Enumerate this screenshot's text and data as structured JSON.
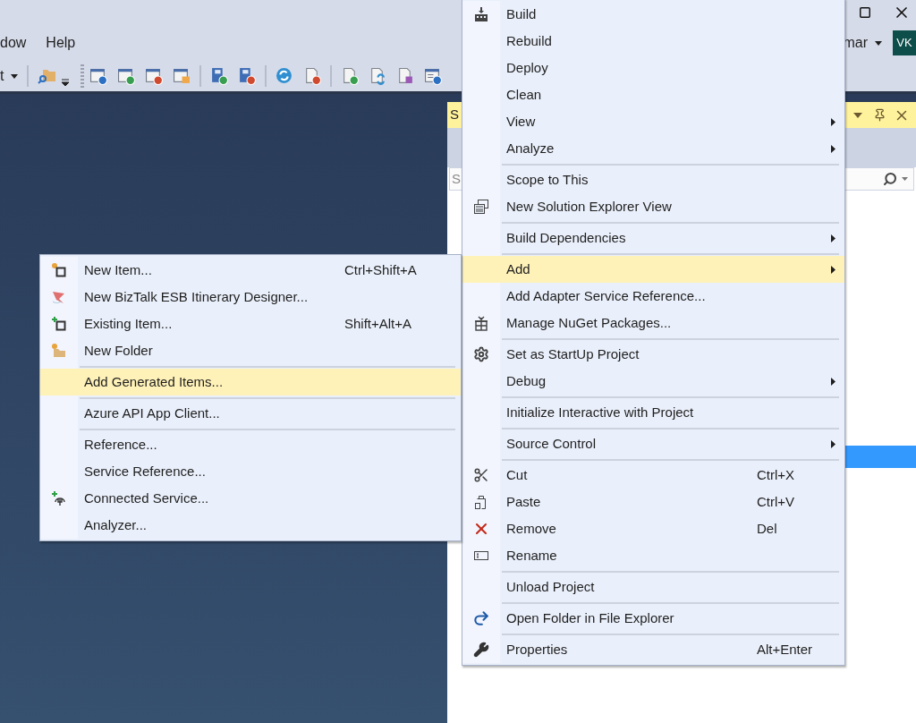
{
  "menu_bar": [
    {
      "label": "dow"
    },
    {
      "label": "Help"
    }
  ],
  "toolbar": {
    "dropdown": "t"
  },
  "account": {
    "name": "mar",
    "initials": "VK"
  },
  "solution_explorer": {
    "title": "S",
    "search_placeholder": "S"
  },
  "context_menu": {
    "items": [
      {
        "kind": "item",
        "label": "Build",
        "selected": false
      },
      {
        "kind": "item",
        "label": "Rebuild",
        "selected": false
      },
      {
        "kind": "item",
        "label": "Deploy",
        "selected": false
      },
      {
        "kind": "item",
        "label": "Clean",
        "selected": false
      },
      {
        "kind": "item",
        "label": "View",
        "submenu": true,
        "selected": false
      },
      {
        "kind": "item",
        "label": "Analyze",
        "submenu": true,
        "selected": false
      },
      {
        "kind": "separator"
      },
      {
        "kind": "item",
        "label": "Scope to This",
        "selected": false
      },
      {
        "kind": "item",
        "label": "New Solution Explorer View",
        "selected": false
      },
      {
        "kind": "separator"
      },
      {
        "kind": "item",
        "label": "Build Dependencies",
        "submenu": true,
        "selected": false
      },
      {
        "kind": "separator"
      },
      {
        "kind": "item",
        "label": "Add",
        "submenu": true,
        "selected": true
      },
      {
        "kind": "item",
        "label": "Add Adapter Service Reference...",
        "selected": false
      },
      {
        "kind": "item",
        "label": "Manage NuGet Packages...",
        "selected": false
      },
      {
        "kind": "separator"
      },
      {
        "kind": "item",
        "label": "Set as StartUp Project",
        "selected": false
      },
      {
        "kind": "item",
        "label": "Debug",
        "submenu": true,
        "selected": false
      },
      {
        "kind": "separator"
      },
      {
        "kind": "item",
        "label": "Initialize Interactive with Project",
        "selected": false
      },
      {
        "kind": "separator"
      },
      {
        "kind": "item",
        "label": "Source Control",
        "submenu": true,
        "selected": false
      },
      {
        "kind": "separator"
      },
      {
        "kind": "item",
        "label": "Cut",
        "shortcut": "Ctrl+X",
        "selected": false
      },
      {
        "kind": "item",
        "label": "Paste",
        "shortcut": "Ctrl+V",
        "selected": false
      },
      {
        "kind": "item",
        "label": "Remove",
        "shortcut": "Del",
        "selected": false
      },
      {
        "kind": "item",
        "label": "Rename",
        "selected": false
      },
      {
        "kind": "separator"
      },
      {
        "kind": "item",
        "label": "Unload Project",
        "selected": false
      },
      {
        "kind": "separator"
      },
      {
        "kind": "item",
        "label": "Open Folder in File Explorer",
        "selected": false
      },
      {
        "kind": "separator"
      },
      {
        "kind": "item",
        "label": "Properties",
        "shortcut": "Alt+Enter",
        "selected": false
      }
    ]
  },
  "add_submenu": {
    "items": [
      {
        "kind": "item",
        "label": "New Item...",
        "shortcut": "Ctrl+Shift+A",
        "selected": false
      },
      {
        "kind": "item",
        "label": "New BizTalk ESB Itinerary Designer...",
        "selected": false
      },
      {
        "kind": "item",
        "label": "Existing Item...",
        "shortcut": "Shift+Alt+A",
        "selected": false
      },
      {
        "kind": "item",
        "label": "New Folder",
        "selected": false
      },
      {
        "kind": "separator"
      },
      {
        "kind": "item",
        "label": "Add Generated Items...",
        "selected": true
      },
      {
        "kind": "separator"
      },
      {
        "kind": "item",
        "label": "Azure API App Client...",
        "selected": false
      },
      {
        "kind": "separator"
      },
      {
        "kind": "item",
        "label": "Reference...",
        "selected": false
      },
      {
        "kind": "item",
        "label": "Service Reference...",
        "selected": false
      },
      {
        "kind": "item",
        "label": "Connected Service...",
        "selected": false
      },
      {
        "kind": "item",
        "label": "Analyzer...",
        "selected": false
      }
    ]
  }
}
